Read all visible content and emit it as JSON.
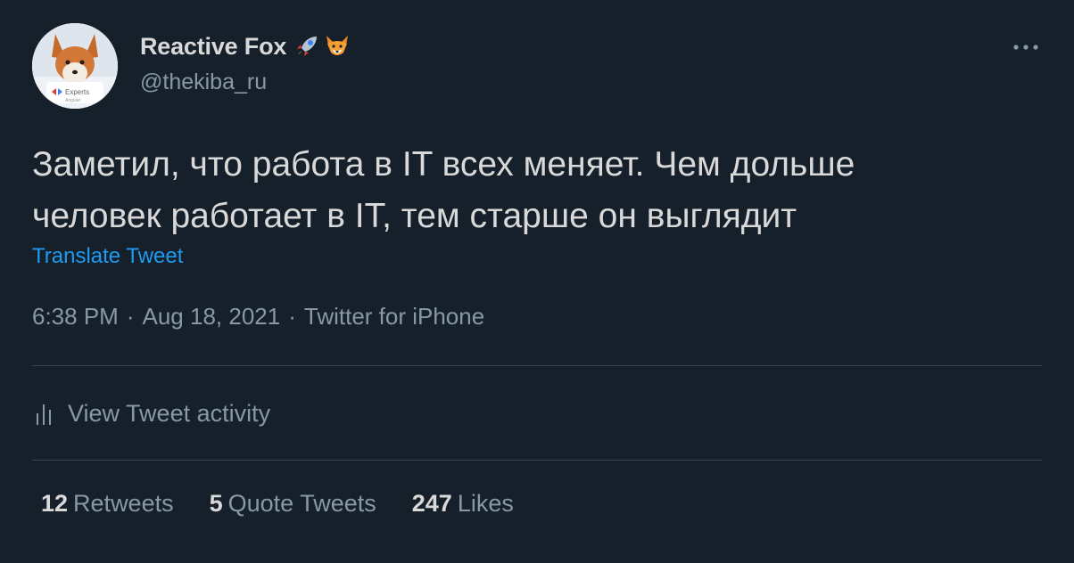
{
  "user": {
    "display_name": "Reactive Fox",
    "name_emojis": [
      "rocket-emoji",
      "fox-emoji"
    ],
    "handle": "@thekiba_ru",
    "avatar_badge": "Experts",
    "avatar_badge_sub": "Angular"
  },
  "tweet": {
    "text_line1": "Заметил, что работа в IT всех меняет. Чем дольше",
    "text_line2": "человек работает в IT, тем старше он выглядит",
    "translate_label": "Translate Tweet",
    "time": "6:38 PM",
    "date": "Aug 18, 2021",
    "source": "Twitter for iPhone",
    "separator": "·"
  },
  "activity": {
    "icon": "bar-chart-icon",
    "label": "View Tweet activity"
  },
  "stats": {
    "retweets_count": "12",
    "retweets_label": "Retweets",
    "quotes_count": "5",
    "quotes_label": "Quote Tweets",
    "likes_count": "247",
    "likes_label": "Likes"
  },
  "colors": {
    "background": "#15202b",
    "primary_text": "#d9d9d9",
    "secondary_text": "#8899a6",
    "link": "#1d9bf0",
    "divider": "#38444d"
  }
}
